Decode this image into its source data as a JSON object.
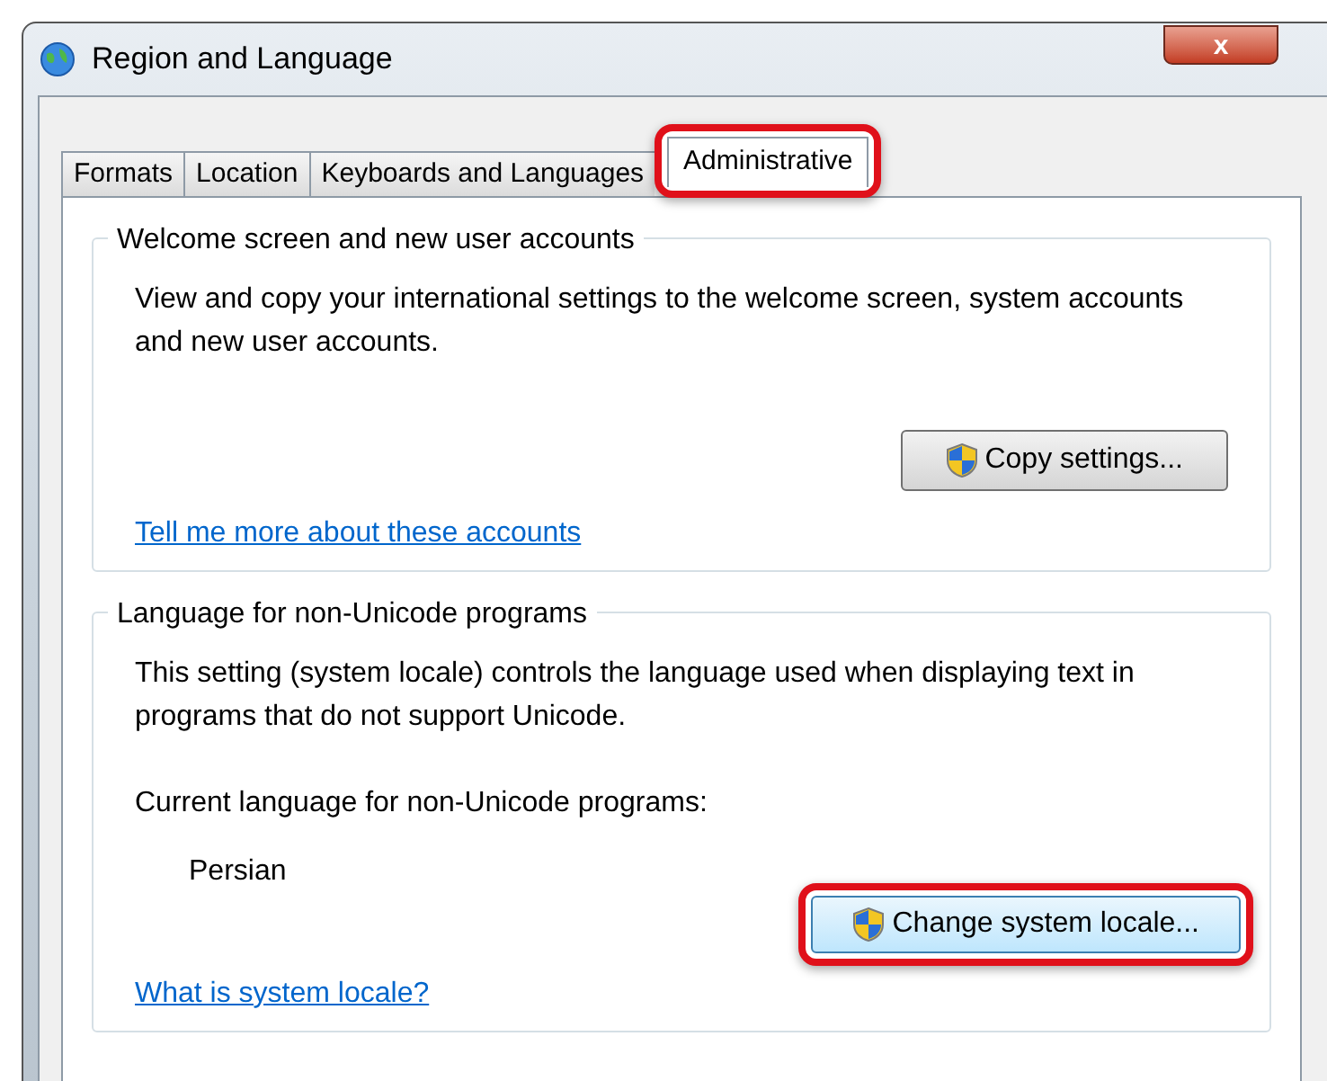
{
  "window": {
    "title": "Region and Language",
    "close": "x"
  },
  "tabs": [
    {
      "label": "Formats",
      "selected": false,
      "highlighted": false
    },
    {
      "label": "Location",
      "selected": false,
      "highlighted": false
    },
    {
      "label": "Keyboards and Languages",
      "selected": false,
      "highlighted": false
    },
    {
      "label": "Administrative",
      "selected": true,
      "highlighted": true
    }
  ],
  "groups": [
    {
      "title": "Welcome screen and new user accounts",
      "items": [
        {
          "kind": "text",
          "text": "View and copy your international settings to the welcome screen, system accounts and new user accounts."
        },
        {
          "kind": "button",
          "label": "Copy settings...",
          "shield": true,
          "highlighted": false
        },
        {
          "kind": "link",
          "text": "Tell me more about these accounts"
        }
      ]
    },
    {
      "title": "Language for non-Unicode programs",
      "items": [
        {
          "kind": "text",
          "text": "This setting (system locale) controls the language used when displaying text in programs that do not support Unicode."
        },
        {
          "kind": "label",
          "text": "Current language for non-Unicode programs:"
        },
        {
          "kind": "value",
          "text": "Persian"
        },
        {
          "kind": "button",
          "label": "Change system locale...",
          "shield": true,
          "highlighted": true
        },
        {
          "kind": "link",
          "text": "What is system locale?"
        }
      ]
    }
  ]
}
